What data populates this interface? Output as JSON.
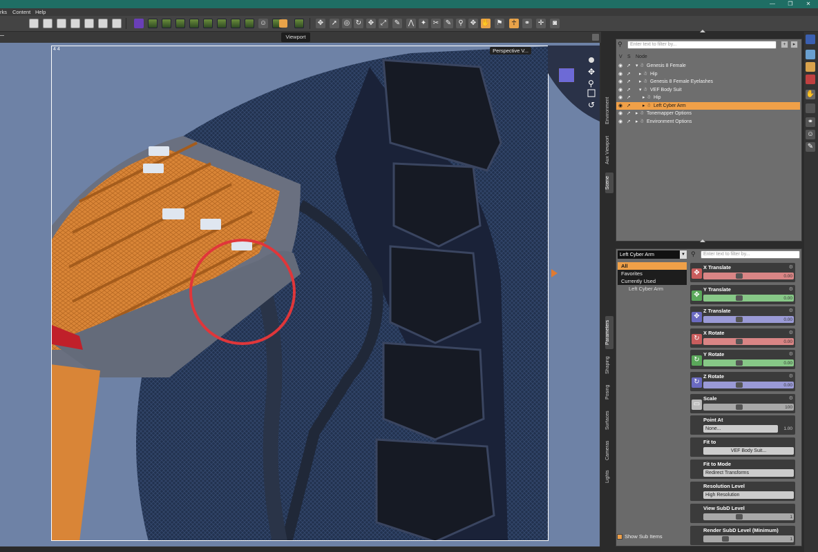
{
  "menu": {
    "items": [
      "rks",
      "Content",
      "Help"
    ]
  },
  "window_controls": {
    "minimize": "—",
    "restore": "❐",
    "close": "✕"
  },
  "viewport": {
    "tab_label": "Viewport",
    "corner_label": "4  4",
    "camera_label": "Perspective V..."
  },
  "scene": {
    "filter_placeholder": "Enter text to filter by...",
    "col_v": "V",
    "col_s": "S",
    "col_node": "Node",
    "tree": [
      {
        "label": "Genesis 8 Female",
        "depth": 0,
        "expanded": true,
        "selected": false
      },
      {
        "label": "Hip",
        "depth": 1,
        "expanded": false,
        "selected": false
      },
      {
        "label": "Genesis 8 Female Eyelashes",
        "depth": 1,
        "expanded": false,
        "selected": false
      },
      {
        "label": "VEF Body Suit",
        "depth": 1,
        "expanded": true,
        "selected": false
      },
      {
        "label": "Hip",
        "depth": 2,
        "expanded": false,
        "selected": false
      },
      {
        "label": "Left Cyber Arm",
        "depth": 2,
        "expanded": false,
        "selected": true
      },
      {
        "label": "Tonemapper Options",
        "depth": 0,
        "expanded": false,
        "selected": false
      },
      {
        "label": "Environment Options",
        "depth": 0,
        "expanded": false,
        "selected": false
      }
    ]
  },
  "side_tabs_top": [
    "Environment",
    "Aux Viewport",
    "Scene"
  ],
  "side_tabs_bottom": [
    "Parameters",
    "Shaping",
    "Posing",
    "Surfaces",
    "Cameras",
    "Lights"
  ],
  "params": {
    "node_selector": "Left Cyber Arm",
    "filter_placeholder": "Enter text to filter by...",
    "groups": [
      "All",
      "Favorites",
      "Currently Used",
      "Left Cyber Arm"
    ],
    "sliders": [
      {
        "label": "X Translate",
        "value": "0.00",
        "color": "red",
        "icon": "✥"
      },
      {
        "label": "Y Translate",
        "value": "0.00",
        "color": "green",
        "icon": "✥"
      },
      {
        "label": "Z Translate",
        "value": "0.00",
        "color": "blue",
        "icon": "✥"
      },
      {
        "label": "X Rotate",
        "value": "0.00",
        "color": "red",
        "icon": "↻"
      },
      {
        "label": "Y Rotate",
        "value": "0.00",
        "color": "green",
        "icon": "↻"
      },
      {
        "label": "Z Rotate",
        "value": "0.00",
        "color": "blue",
        "icon": "↻"
      },
      {
        "label": "Scale",
        "value": "100",
        "color": "gray",
        "icon": "▭"
      }
    ],
    "point_at": {
      "label": "Point At",
      "value": "None...",
      "num": "1.00"
    },
    "fit_to": {
      "label": "Fit to",
      "value": "VEF Body Suit..."
    },
    "fit_to_mode": {
      "label": "Fit to Mode",
      "value": "Redirect Transforms"
    },
    "resolution_level": {
      "label": "Resolution Level",
      "value": "High Resolution"
    },
    "view_subd": {
      "label": "View SubD Level",
      "value": "1"
    },
    "render_subd": {
      "label": "Render SubD Level (Minimum)",
      "value": "1"
    },
    "show_sub_items": "Show Sub Items"
  },
  "colors": {
    "titlebar": "#1f6e64",
    "selection": "#f0a048",
    "viewport_bg": "#6e82a6",
    "suit": "#1e2c44",
    "armor": "#d97d30",
    "highlight_circle": "#e0363a"
  }
}
